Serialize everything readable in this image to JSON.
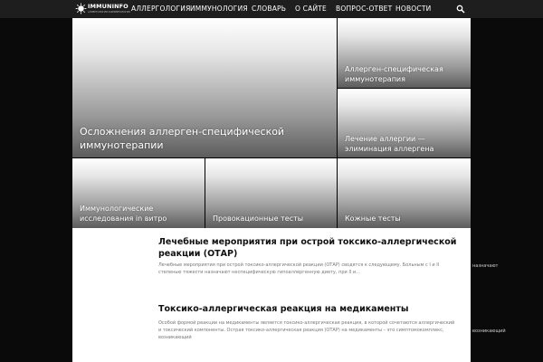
{
  "brand": {
    "name": "IMMUNINFO",
    "tagline": "АЛЛЕРГОЛОГИЯ И ИММУНОЛОГИЯ"
  },
  "nav": {
    "items": [
      {
        "label": "АЛЛЕРГОЛОГИЯ"
      },
      {
        "label": "ИММУНОЛОГИЯ"
      },
      {
        "label": "СЛОВАРЬ"
      },
      {
        "label": "О САЙТЕ"
      },
      {
        "label": "ВОПРОС-ОТВЕТ"
      },
      {
        "label": "НОВОСТИ"
      }
    ]
  },
  "featured": {
    "main": "Осложнения аллерген-специфической иммунотерапии",
    "side_top": "Аллерген-специфическая иммунотерапия",
    "side_bottom": "Лечение аллергии — элиминация аллергена",
    "bottom": [
      "Иммунологические исследования in витро",
      "Провокационные тесты",
      "Кожные тесты"
    ]
  },
  "articles": [
    {
      "title": "Лечебные мероприятия при острой токсико-аллергической реакции (ОТАР)",
      "excerpt": "Лечебные мероприятия при острой токсико-аллергической реакции (ОТАР) сводятся к следующему. Больным с I и II степенью тяжести назначают неспецифическую гипоаллергенную диету, при II и...",
      "overflow": "назначают"
    },
    {
      "title": "Токсико-аллергическая реакция на медикаменты",
      "excerpt": "Особой формой реакции на медикаменты является токсико-аллергическая реакция, в которой сочетаются аллергический и токсический компоненты. Острая токсико-аллергическая реакция (ОТАР) на медикаменты – это симптомокомплекс, возникающий",
      "overflow": "возникающий"
    }
  ]
}
